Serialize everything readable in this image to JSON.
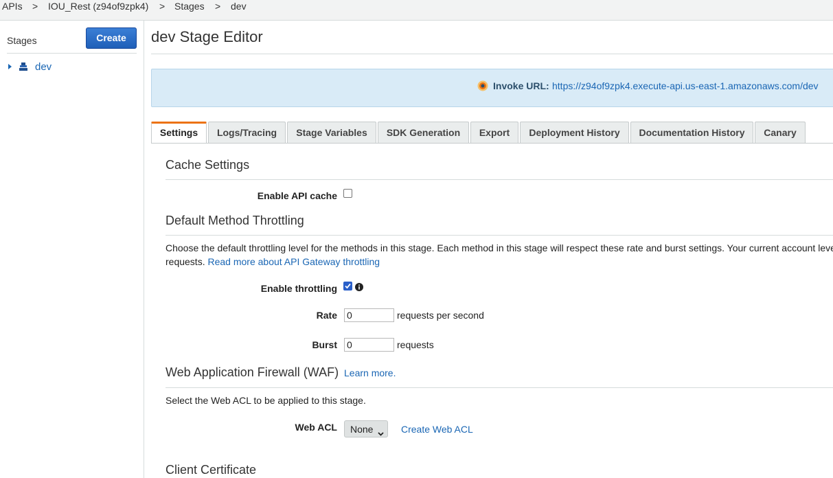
{
  "breadcrumb": {
    "items": [
      "APIs",
      "IOU_Rest (z94of9zpk4)",
      "Stages",
      "dev"
    ],
    "separator": ">"
  },
  "sidebar": {
    "title": "Stages",
    "create_label": "Create",
    "tree": [
      {
        "label": "dev",
        "icon": "stage-icon"
      }
    ]
  },
  "main": {
    "title": "dev Stage Editor",
    "invoke": {
      "label": "Invoke URL:",
      "url": "https://z94of9zpk4.execute-api.us-east-1.amazonaws.com/dev"
    },
    "tabs": [
      {
        "label": "Settings",
        "active": true
      },
      {
        "label": "Logs/Tracing"
      },
      {
        "label": "Stage Variables"
      },
      {
        "label": "SDK Generation"
      },
      {
        "label": "Export"
      },
      {
        "label": "Deployment History"
      },
      {
        "label": "Documentation History"
      },
      {
        "label": "Canary"
      }
    ],
    "cache": {
      "title": "Cache Settings",
      "enable_label": "Enable API cache",
      "enabled": false
    },
    "throttling": {
      "title": "Default Method Throttling",
      "desc_line1": "Choose the default throttling level for the methods in this stage. Each method in this stage will respect these rate and burst settings. Your current account level",
      "desc_line2": "requests.",
      "desc_link": "Read more about API Gateway throttling",
      "enable_label": "Enable throttling",
      "enabled": true,
      "rate_label": "Rate",
      "rate_value": "0",
      "rate_unit": "requests per second",
      "burst_label": "Burst",
      "burst_value": "0",
      "burst_unit": "requests"
    },
    "waf": {
      "title": "Web Application Firewall (WAF)",
      "learn_more": "Learn more.",
      "desc": "Select the Web ACL to be applied to this stage.",
      "acl_label": "Web ACL",
      "acl_value": "None",
      "create_acl": "Create Web ACL"
    },
    "client_cert": {
      "title": "Client Certificate"
    }
  },
  "colors": {
    "accent": "#ec7211",
    "link": "#1a66b4",
    "button": "#1f5fb8",
    "info_bg": "#d9ebf7"
  }
}
